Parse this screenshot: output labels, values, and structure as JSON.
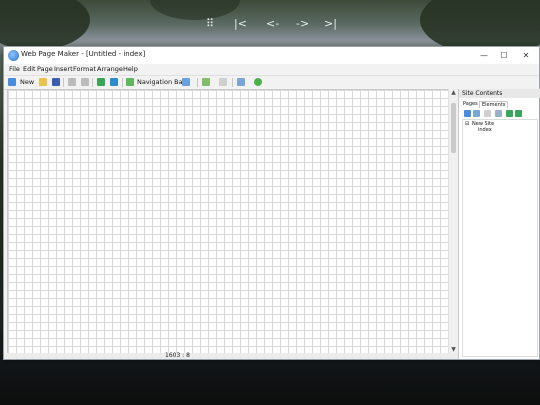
{
  "window": {
    "title": "Web Page Maker - [Untitled - index]",
    "controls": {
      "minimize": "—",
      "maximize": "☐",
      "close": "✕"
    }
  },
  "menu": [
    "File",
    "Edit",
    "Page",
    "Insert",
    "Format",
    "Arrange",
    "Help"
  ],
  "toolbar": {
    "new_label": "New",
    "navigation_bar_label": "Navigation Bar"
  },
  "statusbar": {
    "coords": "1603 : 8"
  },
  "panel": {
    "title": "Site Contents",
    "tabs": [
      "Pages",
      "Elements"
    ],
    "tree": {
      "root": "New Site",
      "child": "index"
    }
  },
  "media_overlay": {
    "grid": "⠿",
    "prev": "|<",
    "back": "<-",
    "forward": "->",
    "next": ">|"
  },
  "colors": {
    "accent": "#2a6fc9",
    "canvas_grid": "#d9d9d9"
  },
  "icons": [
    "app-icon",
    "new-page-icon",
    "open-folder-icon",
    "save-icon",
    "undo-icon",
    "redo-icon",
    "text-icon",
    "image-icon",
    "navigation-bar-icon",
    "shape-icon",
    "table-icon",
    "preview-icon",
    "zoom-icon",
    "publish-icon"
  ]
}
